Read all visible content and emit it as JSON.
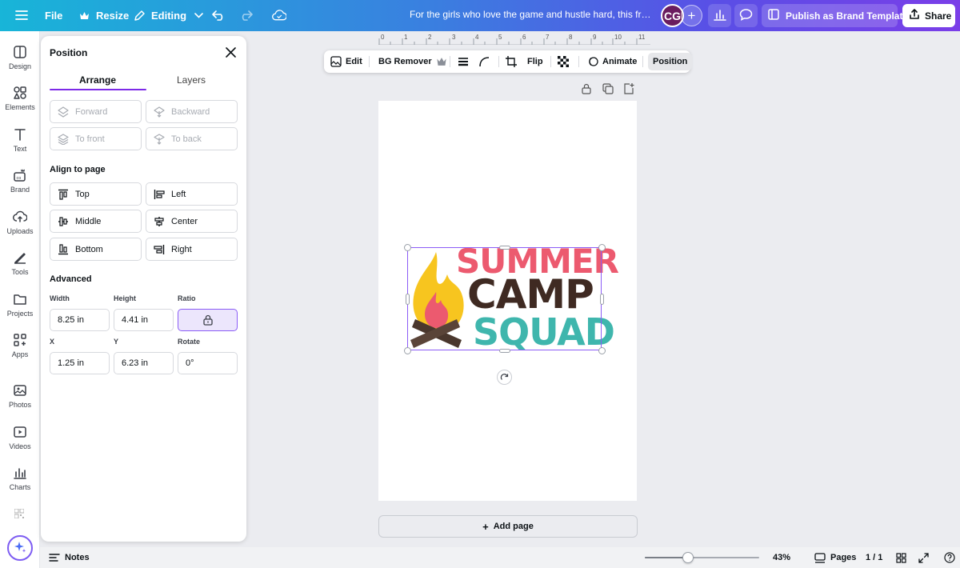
{
  "topbar": {
    "file_label": "File",
    "resize_label": "Resize",
    "editing_label": "Editing",
    "title": "For the girls who love the game and hustle hard, this free Gi...",
    "avatar_initials": "CG",
    "publish_label": "Publish as Brand Template",
    "share_label": "Share"
  },
  "rail": {
    "items": [
      {
        "label": "Design",
        "icon": "design-icon"
      },
      {
        "label": "Elements",
        "icon": "elements-icon"
      },
      {
        "label": "Text",
        "icon": "text-icon"
      },
      {
        "label": "Brand",
        "icon": "brand-icon"
      },
      {
        "label": "Uploads",
        "icon": "uploads-icon"
      },
      {
        "label": "Tools",
        "icon": "tools-icon"
      },
      {
        "label": "Projects",
        "icon": "projects-icon"
      },
      {
        "label": "Apps",
        "icon": "apps-icon"
      },
      {
        "label": "Photos",
        "icon": "photos-icon"
      },
      {
        "label": "Videos",
        "icon": "videos-icon"
      },
      {
        "label": "Charts",
        "icon": "charts-icon"
      }
    ]
  },
  "panel": {
    "title": "Position",
    "tabs": [
      {
        "label": "Arrange"
      },
      {
        "label": "Layers"
      }
    ],
    "order_buttons": {
      "forward": "Forward",
      "backward": "Backward",
      "to_front": "To front",
      "to_back": "To back"
    },
    "align_heading": "Align to page",
    "align": {
      "top": "Top",
      "left": "Left",
      "middle": "Middle",
      "center": "Center",
      "bottom": "Bottom",
      "right": "Right"
    },
    "advanced_heading": "Advanced",
    "fields": {
      "width_label": "Width",
      "width_value": "8.25 in",
      "height_label": "Height",
      "height_value": "4.41 in",
      "ratio_label": "Ratio",
      "x_label": "X",
      "x_value": "1.25 in",
      "y_label": "Y",
      "y_value": "6.23 in",
      "rotate_label": "Rotate",
      "rotate_value": "0°"
    }
  },
  "ruler": {
    "numbers": [
      "0",
      "1",
      "2",
      "3",
      "4",
      "5",
      "6",
      "7",
      "8",
      "9",
      "10",
      "11"
    ]
  },
  "context_toolbar": {
    "edit": "Edit",
    "bg_remover": "BG Remover",
    "flip": "Flip",
    "animate": "Animate",
    "position": "Position"
  },
  "artwork": {
    "line1": "SUMMER",
    "line2": "CAMP",
    "line3": "SQUAD",
    "colors": {
      "summer": "#ec5a6f",
      "camp": "#3f2a22",
      "squad": "#3fb6ad",
      "flame_outer": "#f7c51f",
      "flame_inner": "#ec5a6f",
      "logs": "#4a372d"
    }
  },
  "add_page_label": "Add page",
  "bottombar": {
    "notes_label": "Notes",
    "zoom_label": "43%",
    "zoom_level": 0.38,
    "pages_label": "Pages",
    "page_count": "1 / 1"
  },
  "accent_color": "#7d2ae8"
}
